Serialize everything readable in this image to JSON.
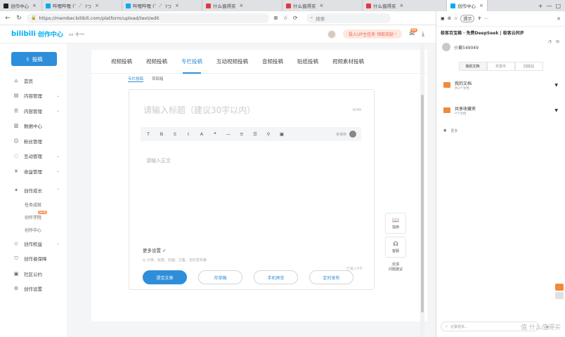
{
  "browser": {
    "tabs": [
      {
        "label": "创作中心",
        "color": "#222",
        "active": false
      },
      {
        "label": "哔哩哔哩 (゜-゜)つ",
        "color": "#00aeec",
        "active": false
      },
      {
        "label": "哔哩哔哩 (゜-゜)つ",
        "color": "#00aeec",
        "active": false
      },
      {
        "label": "什么值得买",
        "color": "#e4393c",
        "active": false
      },
      {
        "label": "什么值得买",
        "color": "#e4393c",
        "active": false
      },
      {
        "label": "什么值得买",
        "color": "#e4393c",
        "active": false
      },
      {
        "label": "创作中心",
        "color": "#00aeec",
        "active": true
      }
    ],
    "url": "https://member.bilibili.com/platform/upload/text/edit",
    "search_placeholder": "搜索"
  },
  "header": {
    "logo": "bilibili",
    "logo_suffix": "创作中心",
    "tv_label": "十一",
    "promo": "投入UP主任务 领取奖励",
    "msg_badge": "99"
  },
  "sidebar": {
    "upload_label": "投稿",
    "items": [
      {
        "label": "首页",
        "icon": "home-icon",
        "glyph": "⌂",
        "arrow": false
      },
      {
        "label": "内容管理",
        "icon": "content-icon",
        "glyph": "▤",
        "arrow": true
      },
      {
        "label": "内容管理",
        "icon": "manage-icon",
        "glyph": "☰",
        "arrow": true
      },
      {
        "label": "数据中心",
        "icon": "data-icon",
        "glyph": "▥",
        "arrow": false
      },
      {
        "label": "粉丝管理",
        "icon": "fans-icon",
        "glyph": "☺",
        "arrow": false
      },
      {
        "label": "互动管理",
        "icon": "interact-icon",
        "glyph": "◌",
        "arrow": true
      },
      {
        "label": "收益管理",
        "icon": "income-icon",
        "glyph": "¥",
        "arrow": true
      }
    ],
    "growth": {
      "label": "创作成长",
      "icon": "growth-icon",
      "glyph": "✦"
    },
    "growth_sub": [
      "任务成就",
      "创作学院",
      "创作中心"
    ],
    "growth_sub_new": "NEW",
    "bottom": [
      {
        "label": "创作权益",
        "icon": "rights-icon",
        "glyph": "◇",
        "arrow": true
      },
      {
        "label": "创作者保障",
        "icon": "shield-icon",
        "glyph": "⛉",
        "arrow": false
      },
      {
        "label": "社区公约",
        "icon": "rules-icon",
        "glyph": "▣",
        "arrow": false
      },
      {
        "label": "创作设置",
        "icon": "gear-icon",
        "glyph": "⚙",
        "arrow": false
      }
    ]
  },
  "main": {
    "tabs": [
      "视频投稿",
      "视频投稿",
      "专栏投稿",
      "互动视频投稿",
      "音频投稿",
      "贴纸投稿",
      "视频素材投稿"
    ],
    "active_tab": 2,
    "subtabs": [
      "专栏投稿",
      "草稿箱"
    ],
    "title_placeholder": "请输入标题（建议30字以内）",
    "title_count": "0/40",
    "toolbar_right": "未保存",
    "body_placeholder": "请输入正文",
    "word_count": "已输入0字",
    "more_settings": "更多设置 ✓",
    "more_hint": "◎ 分类、标签、封面、文集、定时发布等",
    "buttons": {
      "publish": "提交文章",
      "save": "存草稿",
      "preview": "手机预览",
      "timer": "定时发布"
    },
    "float": {
      "guide": "指南",
      "service": "客服",
      "feedback": "反馈\n问题建议"
    }
  },
  "rpanel": {
    "head": "提示",
    "title": "极客百宝箱 · 免费DeepSeek | 极客云同步",
    "user": "小黄549049",
    "tabs": [
      "我的文档",
      "共享中",
      "回收站"
    ],
    "items": [
      {
        "title": "我的文档",
        "sub": "共3个文档"
      },
      {
        "title": "共享收藏夹",
        "sub": "0个文档"
      }
    ],
    "more": "更多",
    "input_placeholder": "记录想法...",
    "watermark": "值 什么值得买"
  }
}
